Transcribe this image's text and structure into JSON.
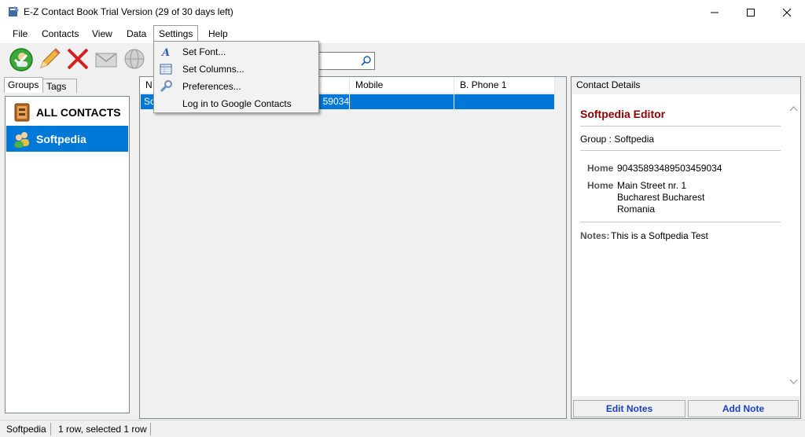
{
  "window": {
    "title": "E-Z Contact Book Trial Version (29 of 30 days left)",
    "controls": [
      "minimize",
      "maximize",
      "close"
    ]
  },
  "menu": {
    "items": [
      "File",
      "Contacts",
      "View",
      "Data",
      "Settings",
      "Help"
    ],
    "open_menu": "Settings"
  },
  "settings_menu": {
    "items": [
      {
        "label": "Set Font...",
        "icon": "font-icon"
      },
      {
        "label": "Set Columns...",
        "icon": "columns-icon"
      },
      {
        "label": "Preferences...",
        "icon": "wrench-icon"
      },
      {
        "label": "Log in to Google Contacts",
        "icon": ""
      }
    ]
  },
  "toolbar": {
    "buttons": [
      "add-contact",
      "edit-contact",
      "delete-contact",
      "email",
      "globe"
    ],
    "search_placeholder": ""
  },
  "left_tabs": [
    "Groups",
    "Tags"
  ],
  "active_left_tab": "Groups",
  "groups": [
    {
      "label": "ALL CONTACTS",
      "icon": "address-book-icon",
      "selected": false
    },
    {
      "label": "Softpedia",
      "icon": "people-icon",
      "selected": true
    }
  ],
  "contact_list": {
    "columns": [
      "N",
      "Mobile",
      "B. Phone 1"
    ],
    "rows": [
      {
        "name": "So",
        "home_phone": "59034",
        "mobile": "",
        "b_phone_1": ""
      }
    ]
  },
  "details": {
    "title": "Contact Details",
    "name": "Softpedia Editor",
    "group": "Group : Softpedia",
    "phone_label": "Home",
    "phone_value": "90435893489503459034",
    "address_label": "Home",
    "address_line1": "Main Street nr. 1",
    "address_line2": "Bucharest Bucharest",
    "address_line3": "Romania",
    "notes_label": "Notes:",
    "notes_value": "This is a Softpedia Test",
    "edit_notes_button": "Edit Notes",
    "add_note_button": "Add Note"
  },
  "status": {
    "group": "Softpedia",
    "rows": "1 row, selected 1 row"
  },
  "colors": {
    "selection": "#0078d7",
    "contact_name": "#8b0000",
    "link_button": "#1a3fc4"
  }
}
